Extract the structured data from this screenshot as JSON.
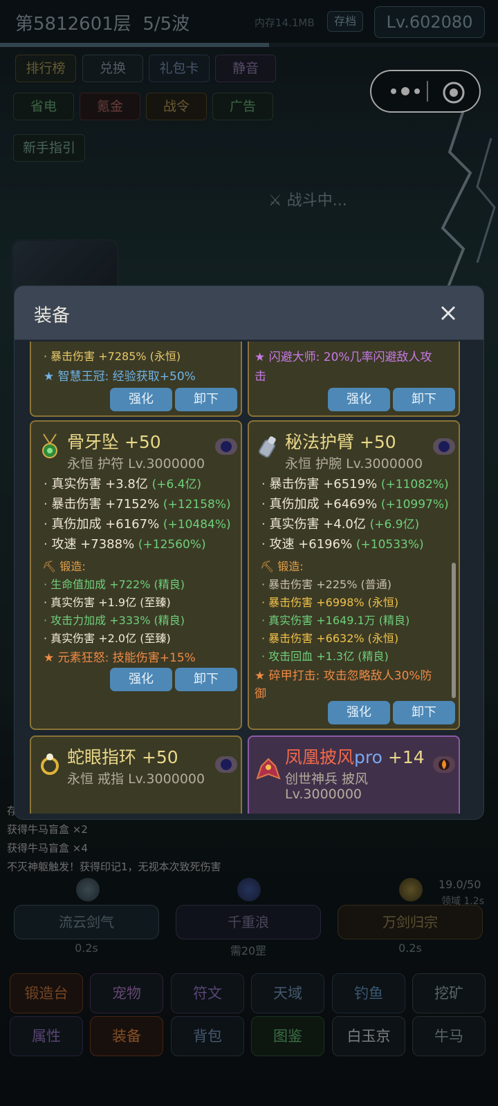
{
  "header": {
    "level": "第5812601层",
    "wave": "5/5波",
    "memory": "内存14.1MB",
    "save": "存档",
    "player_level": "Lv.602080",
    "progress": 0.54
  },
  "menu": [
    "排行榜",
    "兑换",
    "礼包卡",
    "静音",
    "省电",
    "氪金",
    "战令",
    "广告",
    "新手指引"
  ],
  "status_text": "战斗中...",
  "modal": {
    "title": "装备",
    "cards": [
      {
        "lines": [
          "· 暴击伤害 +7285% (永恒)",
          "★ 智慧王冠: 经验获取+50%"
        ],
        "btn_enhance": "强化",
        "btn_remove": "卸下"
      },
      {
        "lines": [
          "★ 闪避大师: 20%几率闪避敌人攻",
          "击"
        ],
        "btn_enhance": "强化",
        "btn_remove": "卸下"
      },
      {
        "name": "骨牙坠 +50",
        "meta": "永恒  护符   Lv.3000000",
        "stats": [
          {
            "label": "真实伤害 +3.8亿",
            "bonus": "(+6.4亿)"
          },
          {
            "label": "暴击伤害 +7152%",
            "bonus": "(+12158%)"
          },
          {
            "label": "真伤加成 +6167%",
            "bonus": "(+10484%)"
          },
          {
            "label": "攻速 +7388%",
            "bonus": "(+12560%)"
          }
        ],
        "forge_title": "锻造:",
        "forge": [
          "生命值加成 +722% (精良)",
          "真实伤害 +1.9亿 (至臻)",
          "攻击力加成 +333% (精良)",
          "真实伤害 +2.0亿 (至臻)"
        ],
        "special": "★ 元素狂怒: 技能伤害+15%",
        "btn_enhance": "强化",
        "btn_remove": "卸下"
      },
      {
        "name": "秘法护臂 +50",
        "meta": "永恒  护腕   Lv.3000000",
        "stats": [
          {
            "label": "暴击伤害 +6519%",
            "bonus": "(+11082%)"
          },
          {
            "label": "真伤加成 +6469%",
            "bonus": "(+10997%)"
          },
          {
            "label": "真实伤害 +4.0亿",
            "bonus": "(+6.9亿)"
          },
          {
            "label": "攻速 +6196%",
            "bonus": "(+10533%)"
          }
        ],
        "forge_title": "锻造:",
        "forge": [
          "暴击伤害 +225% (普通)",
          "暴击伤害 +6998% (永恒)",
          "真实伤害 +1649.1万 (精良)",
          "暴击伤害 +6632% (永恒)",
          "攻击回血 +1.3亿 (精良)"
        ],
        "special": "★ 碎甲打击: 攻击忽略敌人30%防",
        "special_cont": "御",
        "btn_enhance": "强化",
        "btn_remove": "卸下"
      },
      {
        "name": "蛇眼指环 +50",
        "meta": "永恒  戒指   Lv.3000000"
      },
      {
        "name_a": "凤凰披风",
        "name_b": "pro",
        "name_c": " +14",
        "meta": "创世神兵  披风",
        "meta2": "Lv.3000000"
      }
    ]
  },
  "log": [
    "存",
    "获得牛马盲盒 ×2",
    "获得牛马盲盒 ×4",
    "不灭神躯触发！获得印记1，无视本次致死伤害"
  ],
  "skills": {
    "counter": "19.0/50",
    "domain": "领域 1.2s",
    "items": [
      {
        "name": "流云剑气",
        "sub": "0.2s"
      },
      {
        "name": "千重浪",
        "sub": "需20罡"
      },
      {
        "name": "万剑归宗",
        "sub": "0.2s"
      }
    ]
  },
  "nav": [
    "锻造台",
    "宠物",
    "符文",
    "天域",
    "钓鱼",
    "挖矿",
    "属性",
    "装备",
    "背包",
    "图鉴",
    "白玉京",
    "牛马"
  ],
  "colors": {
    "gold": "#ead98a",
    "green": "#6fd07a",
    "blue": "#4d88b6",
    "orange": "#f08a45"
  }
}
